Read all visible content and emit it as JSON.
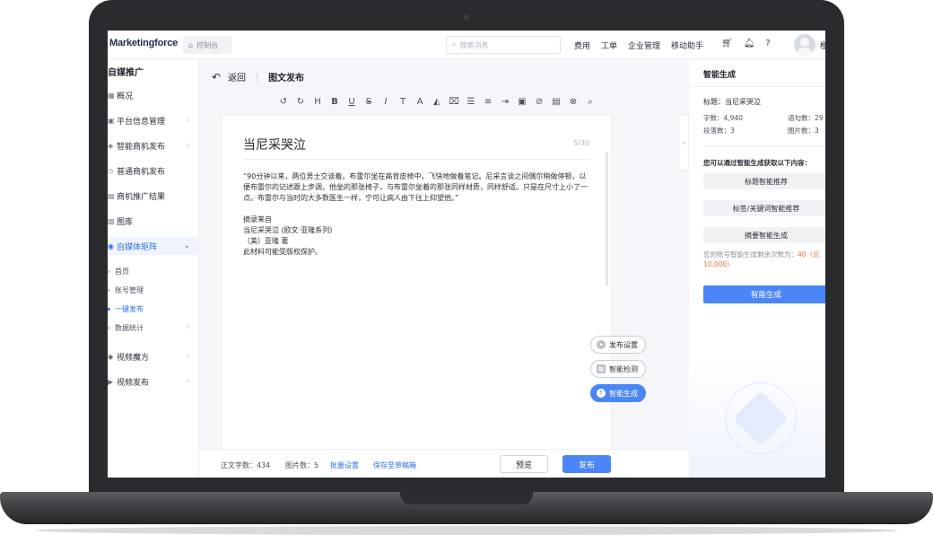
{
  "topbar": {
    "logo": "Marketingforce",
    "console_tab": "控制台",
    "search_placeholder": "搜索消息",
    "nav": [
      "费用",
      "工单",
      "企业管理",
      "移动助手"
    ],
    "user": "樱"
  },
  "sidebar": {
    "title": "自媒推广",
    "items": [
      {
        "label": "概况"
      },
      {
        "label": "平台信息管理"
      },
      {
        "label": "智能商机发布"
      },
      {
        "label": "普通商机发布"
      },
      {
        "label": "商机推广结果"
      },
      {
        "label": "图库"
      },
      {
        "label": "自媒体矩阵"
      },
      {
        "label": "视频魔方"
      },
      {
        "label": "视频发布"
      }
    ],
    "sub_items": [
      {
        "label": "首页"
      },
      {
        "label": "账号管理"
      },
      {
        "label": "一键发布"
      },
      {
        "label": "数据统计"
      }
    ]
  },
  "main": {
    "back": "返回",
    "title": "图文发布",
    "doc": {
      "title": "当尼采哭泣",
      "count": "5/30",
      "para1": "“90分钟以来，两位男士交谈着。布雷尔坐在高背皮椅中，飞快地做着笔记。尼采言谈之间偶尔稍做停顿，以便布雷尔的记述跟上步调，他坐的那张椅子，与布雷尔坐着的那张同样材质，同样舒适。只是在尺寸上小了一点。布雷尔与当时的大多数医生一样，宁可让病人由下往上仰望他。”",
      "line1": "摘录来自",
      "line2": "当尼采哭泣 (欧文·亚隆系列)",
      "line3": "（美）亚隆 著",
      "line4": "此材料可能受版权保护。"
    },
    "float_buttons": {
      "settings": "发布设置",
      "check": "智能检测",
      "generate": "智能生成"
    },
    "footer": {
      "word_count": "正文字数：434",
      "image_count": "图片数：5",
      "batch": "批量设置",
      "save_draft": "保存至草稿箱",
      "preview": "预览",
      "publish": "发布"
    }
  },
  "rpanel": {
    "title": "智能生成",
    "doc_title": "标题：当尼采哭泣",
    "stats": {
      "words": "字数：4,940",
      "sentences": "语句数：29",
      "paragraphs": "段落数：3",
      "images": "图片数：3"
    },
    "intro": "您可以通过智能生成获取以下内容：",
    "options": [
      "标题智能推荐",
      "标签/关键词智能推荐",
      "摘要智能生成"
    ],
    "note_prefix": "您的账号智能生成剩余次数为：",
    "note_value": "40",
    "note_suffix": "（总 10,000）",
    "generate": "智能生成"
  }
}
